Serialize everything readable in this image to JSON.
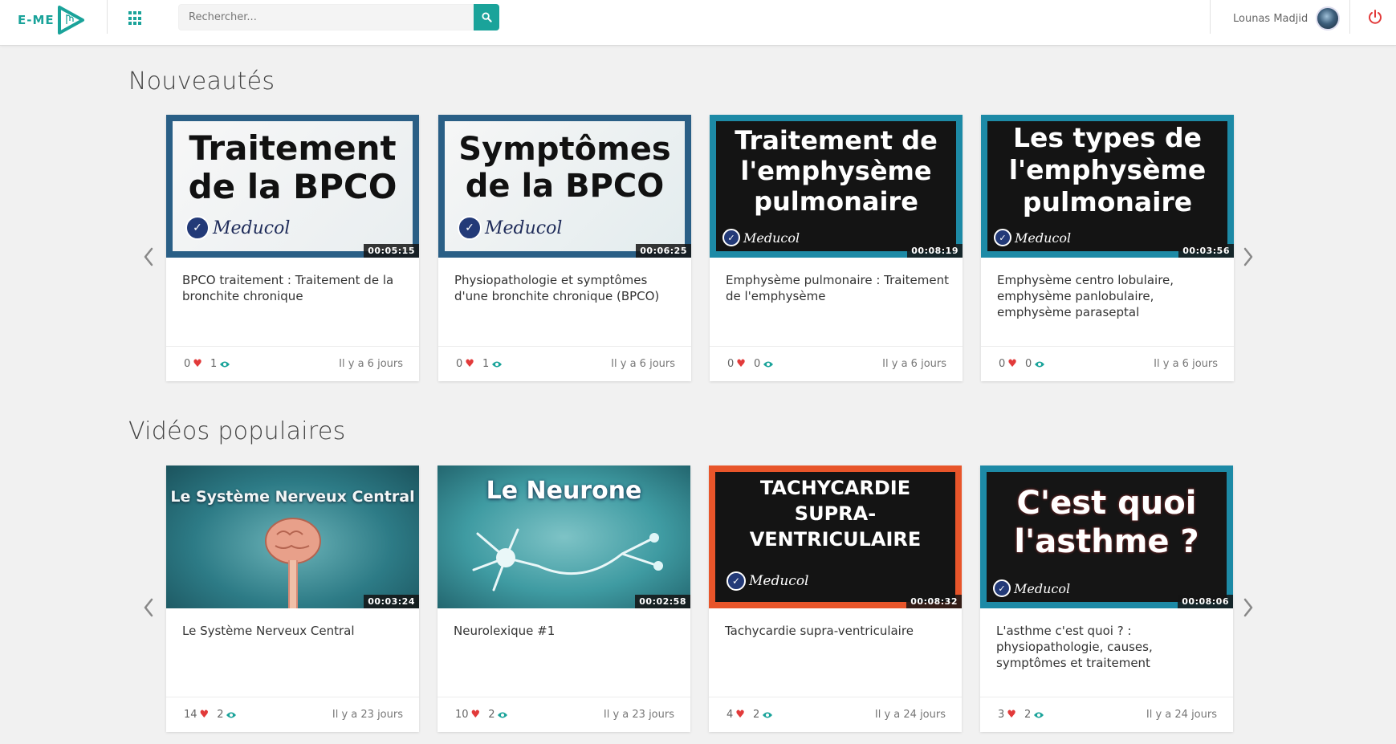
{
  "header": {
    "logo_text": "E-ME",
    "search_placeholder": "Rechercher...",
    "user_name": "Lounas Madjid"
  },
  "colors": {
    "accent": "#1aa39a",
    "heart": "#e23a3a",
    "power": "#e23a3a"
  },
  "sections": [
    {
      "title": "Nouveautés",
      "cards": [
        {
          "thumb_text_1": "Traitement",
          "thumb_text_2": "de la BPCO",
          "brand": "Meducol",
          "duration": "00:05:15",
          "title": "BPCO traitement : Traitement de la bronchite chronique",
          "likes": "0",
          "views": "1",
          "ago": "Il y a 6 jours"
        },
        {
          "thumb_text_1": "Symptômes",
          "thumb_text_2": "de la BPCO",
          "brand": "Meducol",
          "duration": "00:06:25",
          "title": "Physiopathologie et symptômes d'une bronchite chronique (BPCO)",
          "likes": "0",
          "views": "1",
          "ago": "Il y a 6 jours"
        },
        {
          "thumb_text_1": "Traitement de",
          "thumb_text_2": "l'emphysème",
          "thumb_text_3": "pulmonaire",
          "brand": "Meducol",
          "duration": "00:08:19",
          "title": "Emphysème pulmonaire : Traitement de l'emphysème",
          "likes": "0",
          "views": "0",
          "ago": "Il y a 6 jours"
        },
        {
          "thumb_text_1": "Les types de",
          "thumb_text_2": "l'emphysème",
          "thumb_text_3": "pulmonaire",
          "brand": "Meducol",
          "duration": "00:03:56",
          "title": "Emphysème centro lobulaire, emphysème panlobulaire, emphysème paraseptal",
          "likes": "0",
          "views": "0",
          "ago": "Il y a 6 jours"
        }
      ]
    },
    {
      "title": "Vidéos populaires",
      "cards": [
        {
          "thumb_text_1": "Le Système Nerveux Central",
          "duration": "00:03:24",
          "title": "Le Système Nerveux Central",
          "likes": "14",
          "views": "2",
          "ago": "Il y a 23 jours"
        },
        {
          "thumb_text_1": "Le Neurone",
          "duration": "00:02:58",
          "title": "Neurolexique #1",
          "likes": "10",
          "views": "2",
          "ago": "Il y a 23 jours"
        },
        {
          "thumb_text_1": "TACHYCARDIE",
          "thumb_text_2": "SUPRA-",
          "thumb_text_3": "VENTRICULAIRE",
          "brand": "Meducol",
          "duration": "00:08:32",
          "title": "Tachycardie supra-ventriculaire",
          "likes": "4",
          "views": "2",
          "ago": "Il y a 24 jours"
        },
        {
          "thumb_text_1": "C'est quoi",
          "thumb_text_2": "l'asthme ?",
          "brand": "Meducol",
          "duration": "00:08:06",
          "title": "L'asthme c'est quoi ? : physiopathologie, causes, symptômes et traitement",
          "likes": "3",
          "views": "2",
          "ago": "Il y a 24 jours"
        }
      ]
    }
  ]
}
